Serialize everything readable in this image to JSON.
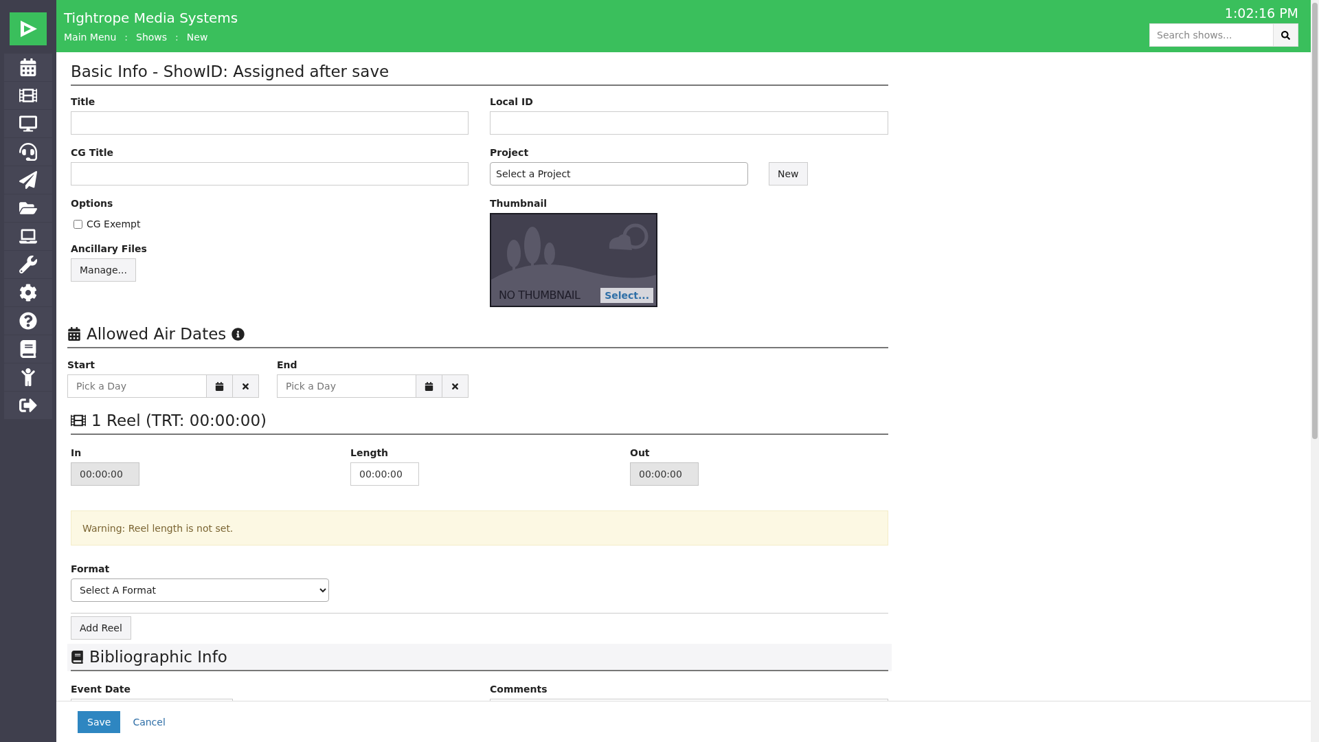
{
  "header": {
    "app_title": "Tightrope Media Systems",
    "breadcrumbs": [
      {
        "label": "Main Menu"
      },
      {
        "label": "Shows"
      },
      {
        "label": "New"
      }
    ],
    "separators": [
      ":",
      ":"
    ],
    "clock": "1:02:16 PM",
    "search": {
      "placeholder": "Search shows..."
    }
  },
  "basic_info": {
    "heading": "Basic Info - ShowID: Assigned after save",
    "title": {
      "label": "Title"
    },
    "cg_title": {
      "label": "CG Title"
    },
    "options": {
      "label": "Options",
      "items": [
        {
          "label": "CG Exempt",
          "checked": false
        }
      ]
    },
    "ancillary": {
      "label": "Ancillary Files",
      "button": "Manage..."
    },
    "local_id": {
      "label": "Local ID"
    },
    "project": {
      "label": "Project",
      "value": "Select a Project",
      "button": "New"
    },
    "thumbnail": {
      "label": "Thumbnail",
      "caption": "NO THUMBNAIL",
      "button": "Select..."
    }
  },
  "air_dates": {
    "heading": "Allowed Air Dates",
    "fields": [
      {
        "label": "Start",
        "placeholder": "Pick a Day"
      },
      {
        "label": "End",
        "placeholder": "Pick a Day"
      }
    ]
  },
  "reel": {
    "heading": "1 Reel (TRT: 00:00:00)",
    "fields": [
      {
        "label": "In",
        "value": "00:00:00",
        "disabled": true
      },
      {
        "label": "Length",
        "value": "00:00:00",
        "disabled": false
      },
      {
        "label": "Out",
        "value": "00:00:00",
        "disabled": true
      }
    ],
    "warning": "Warning: Reel length is not set.",
    "format": {
      "label": "Format",
      "value": "Select A Format"
    },
    "add_button": "Add Reel"
  },
  "bibliographic": {
    "heading": "Bibliographic Info",
    "event_date": {
      "label": "Event Date"
    },
    "comments": {
      "label": "Comments"
    }
  },
  "footer": {
    "save": "Save",
    "cancel": "Cancel"
  }
}
